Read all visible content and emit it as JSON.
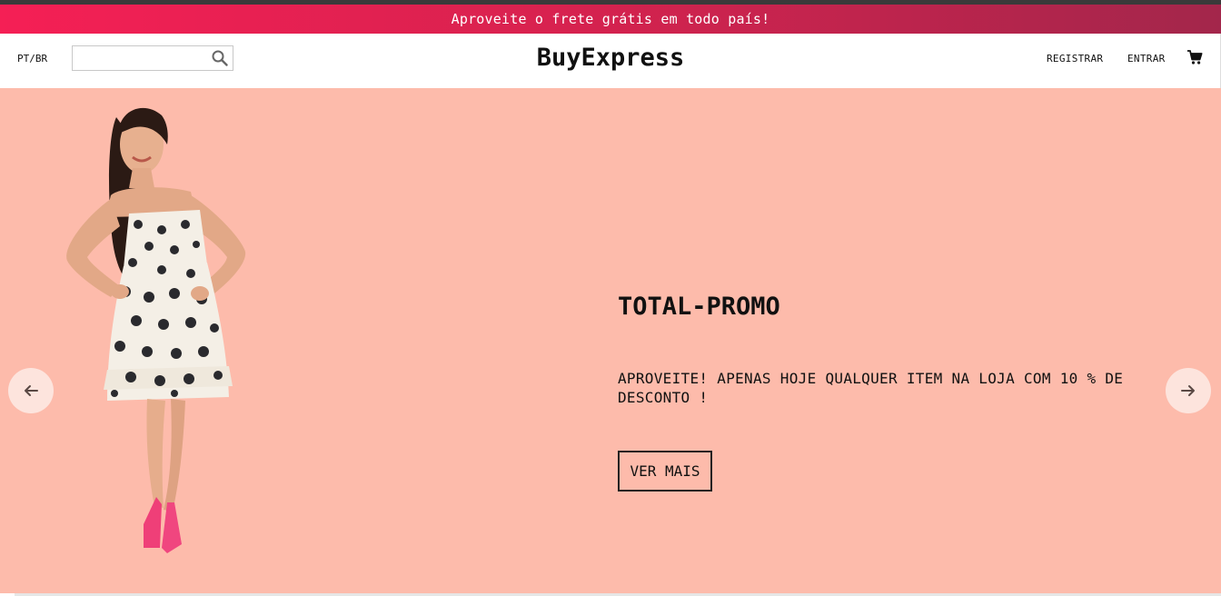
{
  "announcement": {
    "text": "Aproveite o frete grátis em todo país!"
  },
  "header": {
    "language": "PT/BR",
    "search": {
      "value": "",
      "placeholder": ""
    },
    "logo": "BuyExpress",
    "register_label": "REGISTRAR",
    "login_label": "ENTRAR",
    "cart_icon": "shopping-cart-icon",
    "search_icon": "magnifier-icon"
  },
  "slider": {
    "title": "TOTAL-PROMO",
    "description": "APROVEITE! APENAS HOJE QUALQUER ITEM NA LOJA COM 10 % DE DESCONTO !",
    "button_label": "VER MAIS",
    "prev_icon": "arrow-left-icon",
    "next_icon": "arrow-right-icon",
    "background_color": "#fdbbab"
  },
  "colors": {
    "announcement_start": "#f51f55",
    "announcement_end": "#a3264b",
    "hero_background": "#fdbbab"
  }
}
